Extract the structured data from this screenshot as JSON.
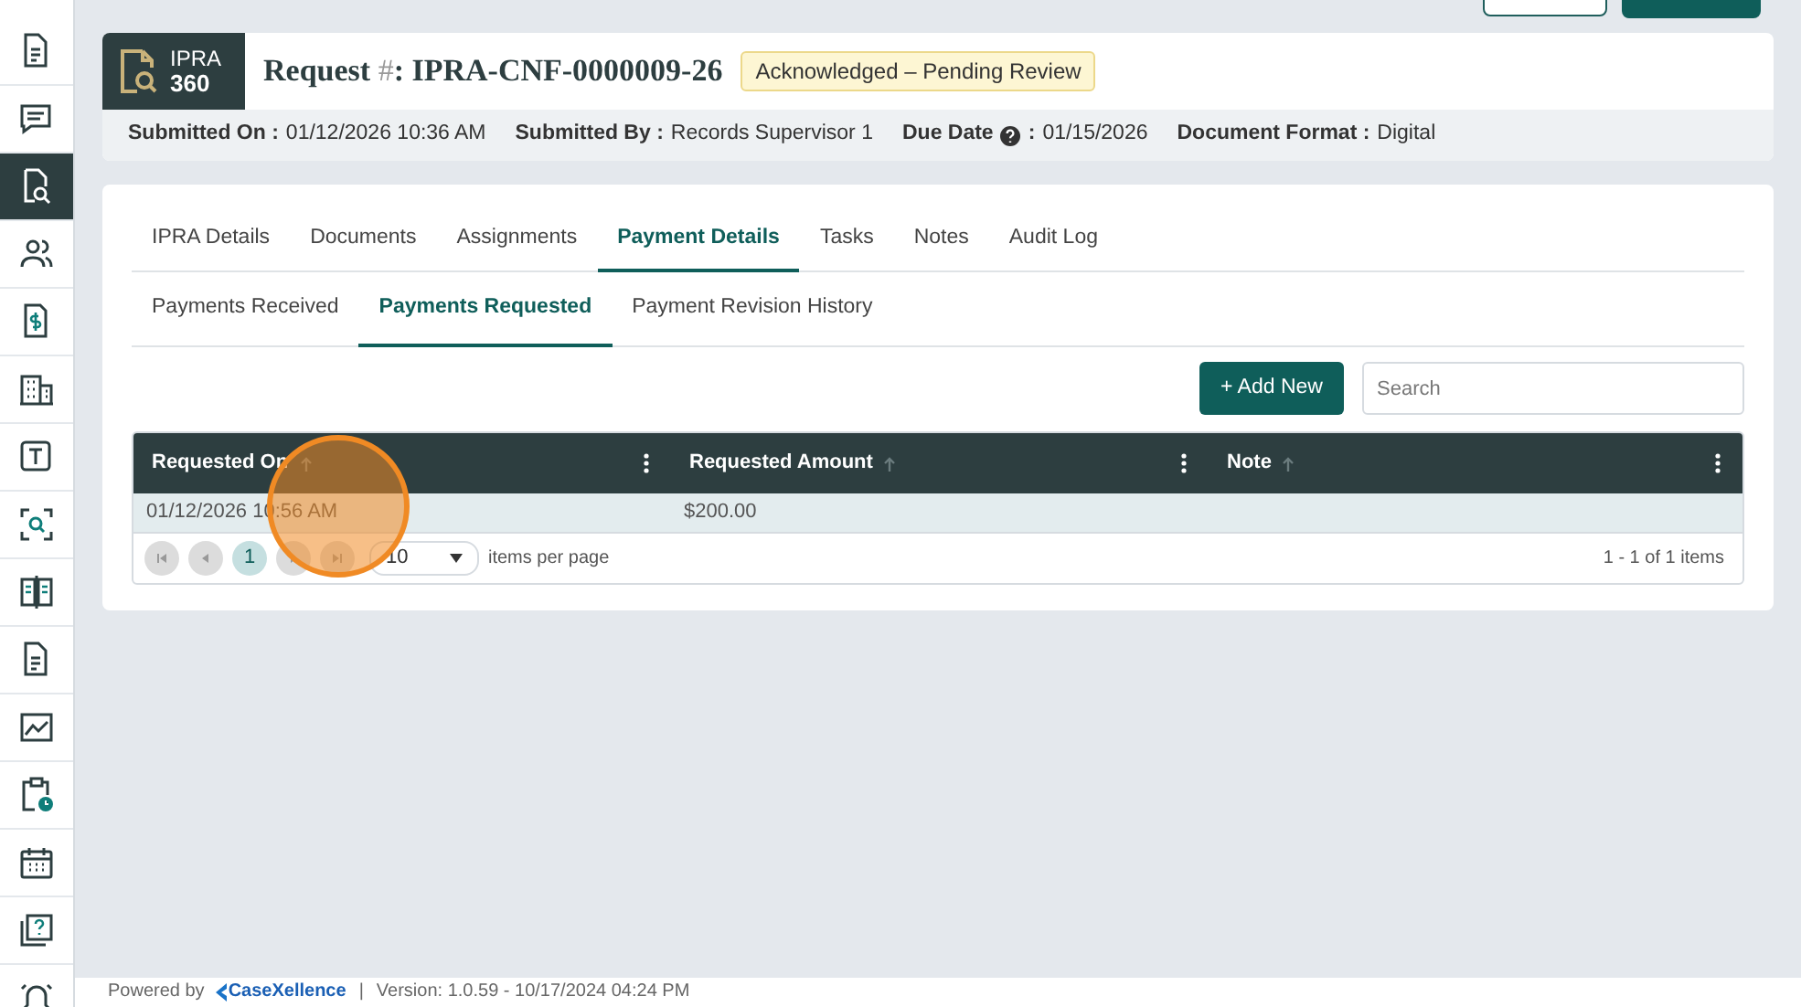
{
  "sidebar": {
    "items": [
      {
        "selected": false
      },
      {
        "selected": false
      },
      {
        "selected": true
      },
      {
        "selected": false
      },
      {
        "selected": false
      },
      {
        "selected": false
      },
      {
        "selected": false
      },
      {
        "selected": false
      },
      {
        "selected": false
      },
      {
        "selected": false
      },
      {
        "selected": false
      },
      {
        "selected": false
      },
      {
        "selected": false
      },
      {
        "selected": false
      },
      {
        "selected": false
      }
    ]
  },
  "header": {
    "logo": {
      "line1": "IPRA",
      "line2": "360"
    },
    "title_label": "Request",
    "title_hash": "#",
    "title_colon": ":",
    "request_number": "IPRA-CNF-0000009-26",
    "status": "Acknowledged – Pending Review",
    "fields": [
      {
        "label": "Submitted On :",
        "value": "01/12/2026 10:36 AM",
        "help": false
      },
      {
        "label": "Submitted By :",
        "value": "Records Supervisor 1",
        "help": false
      },
      {
        "label": "Due Date",
        "label_end": ":",
        "value": "01/15/2026",
        "help": true
      },
      {
        "label": "Document Format :",
        "value": "Digital",
        "help": false
      }
    ]
  },
  "tabs": [
    {
      "label": "IPRA Details",
      "selected": false
    },
    {
      "label": "Documents",
      "selected": false
    },
    {
      "label": "Assignments",
      "selected": false
    },
    {
      "label": "Payment Details",
      "selected": true
    },
    {
      "label": "Tasks",
      "selected": false
    },
    {
      "label": "Notes",
      "selected": false
    },
    {
      "label": "Audit Log",
      "selected": false
    }
  ],
  "subtabs": [
    {
      "label": "Payments Received",
      "selected": false
    },
    {
      "label": "Payments Requested",
      "selected": true
    },
    {
      "label": "Payment Revision History",
      "selected": false
    }
  ],
  "add_button": "+ Add New",
  "search": {
    "placeholder": "Search"
  },
  "table": {
    "columns": [
      "Requested On",
      "Requested Amount",
      "Note"
    ],
    "rows": [
      [
        "01/12/2026 10:56 AM",
        "$200.00",
        ""
      ]
    ]
  },
  "pager": {
    "pages": [
      {
        "label": "1",
        "selected": true
      }
    ],
    "page_size": "10",
    "page_size_label": "items per page",
    "summary": "1 - 1 of 1 items"
  },
  "footer": {
    "powered_by": "Powered by",
    "brand": "CaseXellence",
    "separator": "|",
    "version": "Version: 1.0.59 - 10/17/2024 04:24 PM"
  }
}
